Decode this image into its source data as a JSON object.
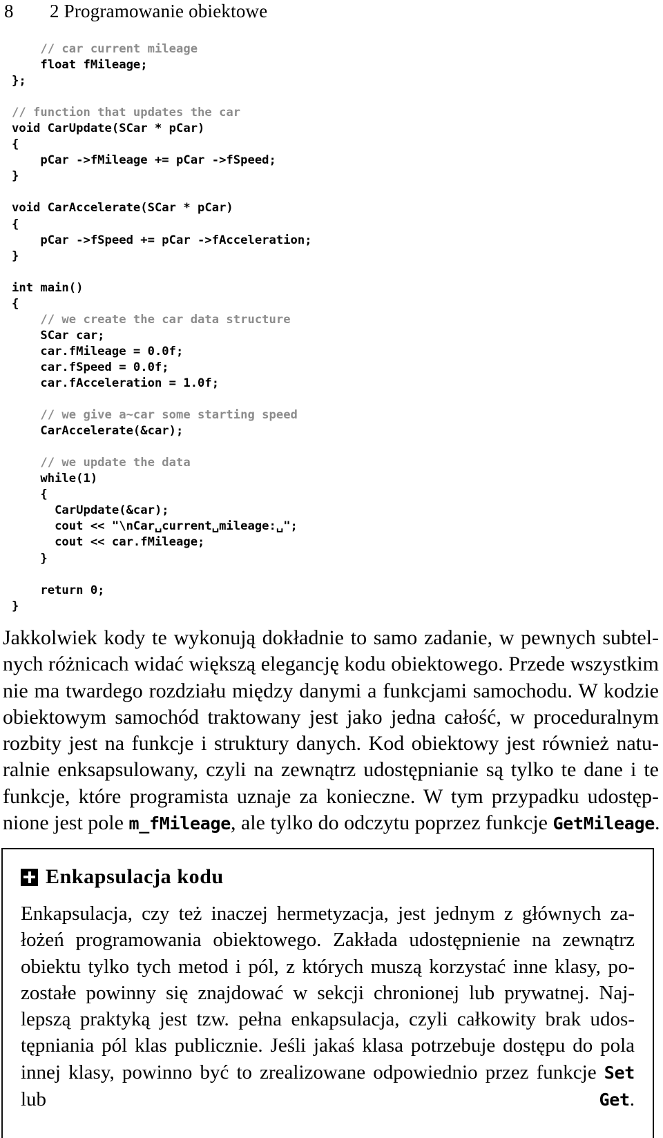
{
  "header": {
    "folio": "8",
    "chapter_title": "2 Programowanie obiektowe"
  },
  "code_listing": {
    "language": "C++",
    "comment_color": "#8c8c8c",
    "lines": [
      {
        "indent": 2,
        "text": "// car current mileage",
        "kind": "comment"
      },
      {
        "indent": 2,
        "text": "float fMileage;",
        "kind": "code"
      },
      {
        "indent": 0,
        "text": "};",
        "kind": "code"
      },
      {
        "indent": 0,
        "text": "",
        "kind": "blank"
      },
      {
        "indent": 0,
        "text": "// function that updates the car",
        "kind": "comment"
      },
      {
        "indent": 0,
        "text": "void CarUpdate(SCar * pCar)",
        "kind": "code"
      },
      {
        "indent": 0,
        "text": "{",
        "kind": "code"
      },
      {
        "indent": 2,
        "text": "pCar ->fMileage += pCar ->fSpeed;",
        "kind": "code"
      },
      {
        "indent": 0,
        "text": "}",
        "kind": "code"
      },
      {
        "indent": 0,
        "text": "",
        "kind": "blank"
      },
      {
        "indent": 0,
        "text": "void CarAccelerate(SCar * pCar)",
        "kind": "code"
      },
      {
        "indent": 0,
        "text": "{",
        "kind": "code"
      },
      {
        "indent": 2,
        "text": "pCar ->fSpeed += pCar ->fAcceleration;",
        "kind": "code"
      },
      {
        "indent": 0,
        "text": "}",
        "kind": "code"
      },
      {
        "indent": 0,
        "text": "",
        "kind": "blank"
      },
      {
        "indent": 0,
        "text": "int main()",
        "kind": "code"
      },
      {
        "indent": 0,
        "text": "{",
        "kind": "code"
      },
      {
        "indent": 2,
        "text": "// we create the car data structure",
        "kind": "comment"
      },
      {
        "indent": 2,
        "text": "SCar car;",
        "kind": "code"
      },
      {
        "indent": 2,
        "text": "car.fMileage = 0.0f;",
        "kind": "code"
      },
      {
        "indent": 2,
        "text": "car.fSpeed = 0.0f;",
        "kind": "code"
      },
      {
        "indent": 2,
        "text": "car.fAcceleration = 1.0f;",
        "kind": "code"
      },
      {
        "indent": 0,
        "text": "",
        "kind": "blank"
      },
      {
        "indent": 2,
        "text": "// we give a~car some starting speed",
        "kind": "comment"
      },
      {
        "indent": 2,
        "text": "CarAccelerate(&car);",
        "kind": "code"
      },
      {
        "indent": 0,
        "text": "",
        "kind": "blank"
      },
      {
        "indent": 2,
        "text": "// we update the data",
        "kind": "comment"
      },
      {
        "indent": 2,
        "text": "while(1)",
        "kind": "code"
      },
      {
        "indent": 2,
        "text": "{",
        "kind": "code"
      },
      {
        "indent": 3,
        "text": "CarUpdate(&car);",
        "kind": "code"
      },
      {
        "indent": 3,
        "text": "cout << \"\\nCar␣current␣mileage:␣\";",
        "kind": "code"
      },
      {
        "indent": 3,
        "text": "cout << car.fMileage;",
        "kind": "code"
      },
      {
        "indent": 2,
        "text": "}",
        "kind": "code"
      },
      {
        "indent": 0,
        "text": "",
        "kind": "blank"
      },
      {
        "indent": 2,
        "text": "return 0;",
        "kind": "code"
      },
      {
        "indent": 0,
        "text": "}",
        "kind": "code"
      }
    ]
  },
  "prose": {
    "line_1": "Jakkolwiek kody te wykonują dokładnie to samo zadanie, w pewnych subtel-",
    "line_2": "nych różnicach widać większą elegancję kodu obiektowego. Przede wszystkim",
    "line_3": "nie ma twardego rozdziału między danymi a funkcjami samochodu. W kodzie",
    "line_4": "obiektowym samochód traktowany jest jako jedna całość, w proceduralnym",
    "line_5": "rozbity jest na funkcje i struktury danych. Kod obiektowy jest również natu-",
    "line_6": "ralnie enksapsulowany, czyli na zewnątrz udostępnianie są tylko te dane i te",
    "line_7": "funkcje, które programista uznaje za konieczne. W tym przypadku udostęp-",
    "line_8_part_1": "nione jest pole ",
    "line_8_code_1": "m_fMileage",
    "line_8_part_2": ", ale tylko do odczytu poprzez funkcje ",
    "line_8_code_2": "GetMileage",
    "line_8_part_3": "."
  },
  "callout": {
    "icon": "plus-square-icon",
    "heading": "Enkapsulacja kodu",
    "body_line_1": "Enkapsulacja, czy też inaczej hermetyzacja, jest jednym z głównych za-",
    "body_line_2": "łożeń programowania obiektowego. Zakłada udostępnienie na zewnątrz",
    "body_line_3": "obiektu tylko tych metod i pól, z których muszą korzystać inne klasy, po-",
    "body_line_4": "zostałe powinny się znajdować w sekcji chronionej lub prywatnej. Naj-",
    "body_line_5": "lepszą praktyką jest tzw. pełna enkapsulacja, czyli całkowity brak udos-",
    "body_line_6": "tępniania pól klas publicznie. Jeśli jakaś klasa potrzebuje dostępu do pola",
    "body_line_7_part_1": "innej klasy, powinno być to zrealizowane odpowiednio przez funkcje ",
    "body_line_7_code": "Set",
    "body_line_8_part_1": "lub ",
    "body_line_8_code": "Get",
    "body_line_8_part_2": "."
  }
}
